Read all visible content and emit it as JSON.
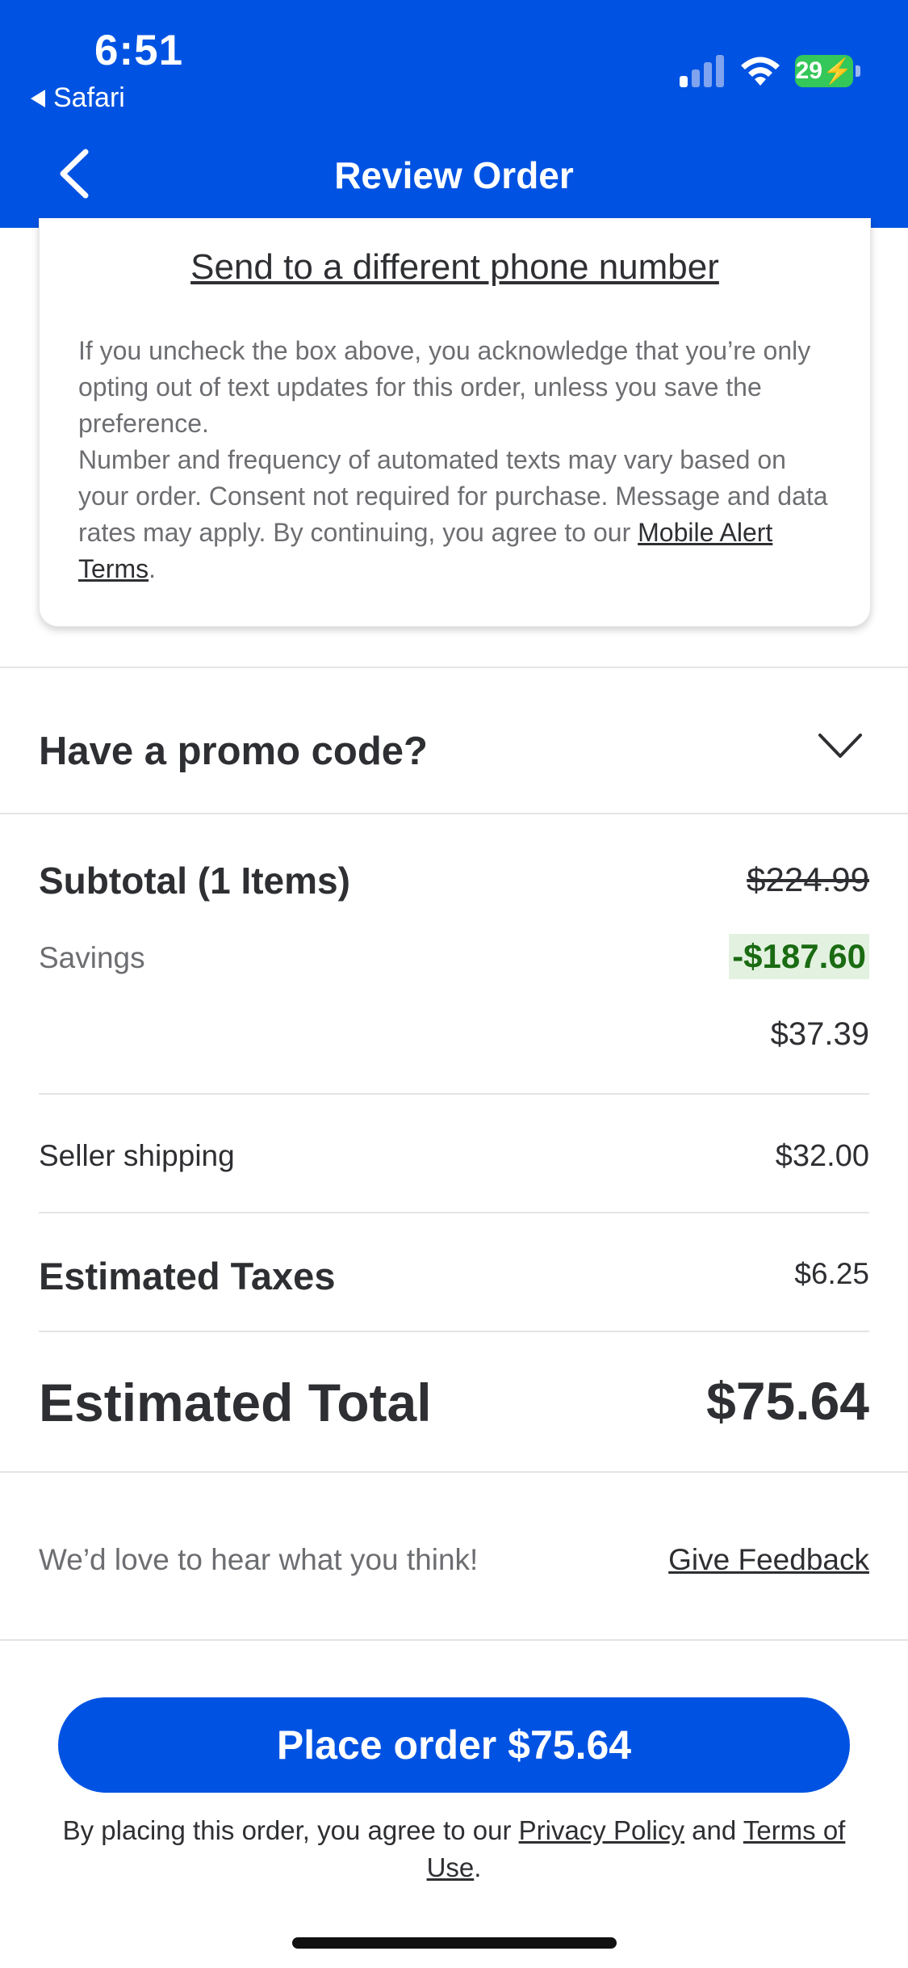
{
  "status_bar": {
    "time": "6:51",
    "back_app": "Safari",
    "battery": "29"
  },
  "header": {
    "title": "Review Order"
  },
  "notifications": {
    "send_different_phone": "Send to a different phone number",
    "disclaimer_part1": "If you uncheck the box above, you acknowledge that you’re only opting out of text updates for this order, unless you save the preference.",
    "disclaimer_part2": "Number and frequency of automated texts may vary based on your order. Consent not required for purchase. Message and data rates may apply. By continuing, you agree to our ",
    "mobile_alert_terms": "Mobile Alert Terms",
    "period": "."
  },
  "promo": {
    "title": "Have a promo code?"
  },
  "summary": {
    "subtotal_label": "Subtotal (1 Items)",
    "subtotal_original": "$224.99",
    "savings_label": "Savings",
    "savings_value": "-$187.60",
    "subtotal_net": "$37.39",
    "shipping_label": "Seller shipping",
    "shipping_value": "$32.00",
    "taxes_label": "Estimated Taxes",
    "taxes_value": "$6.25",
    "total_label": "Estimated Total",
    "total_value": "$75.64"
  },
  "feedback": {
    "prompt": "We’d love to hear what you think!",
    "link": "Give Feedback"
  },
  "footer": {
    "place_order": "Place order $75.64",
    "legal_prefix": "By placing this order, you agree to our ",
    "privacy_policy": "Privacy Policy",
    "and": " and ",
    "terms_of_use": "Terms of Use",
    "period": "."
  },
  "colors": {
    "brand_blue": "#0053e2",
    "savings_green": "#1a6b12"
  }
}
